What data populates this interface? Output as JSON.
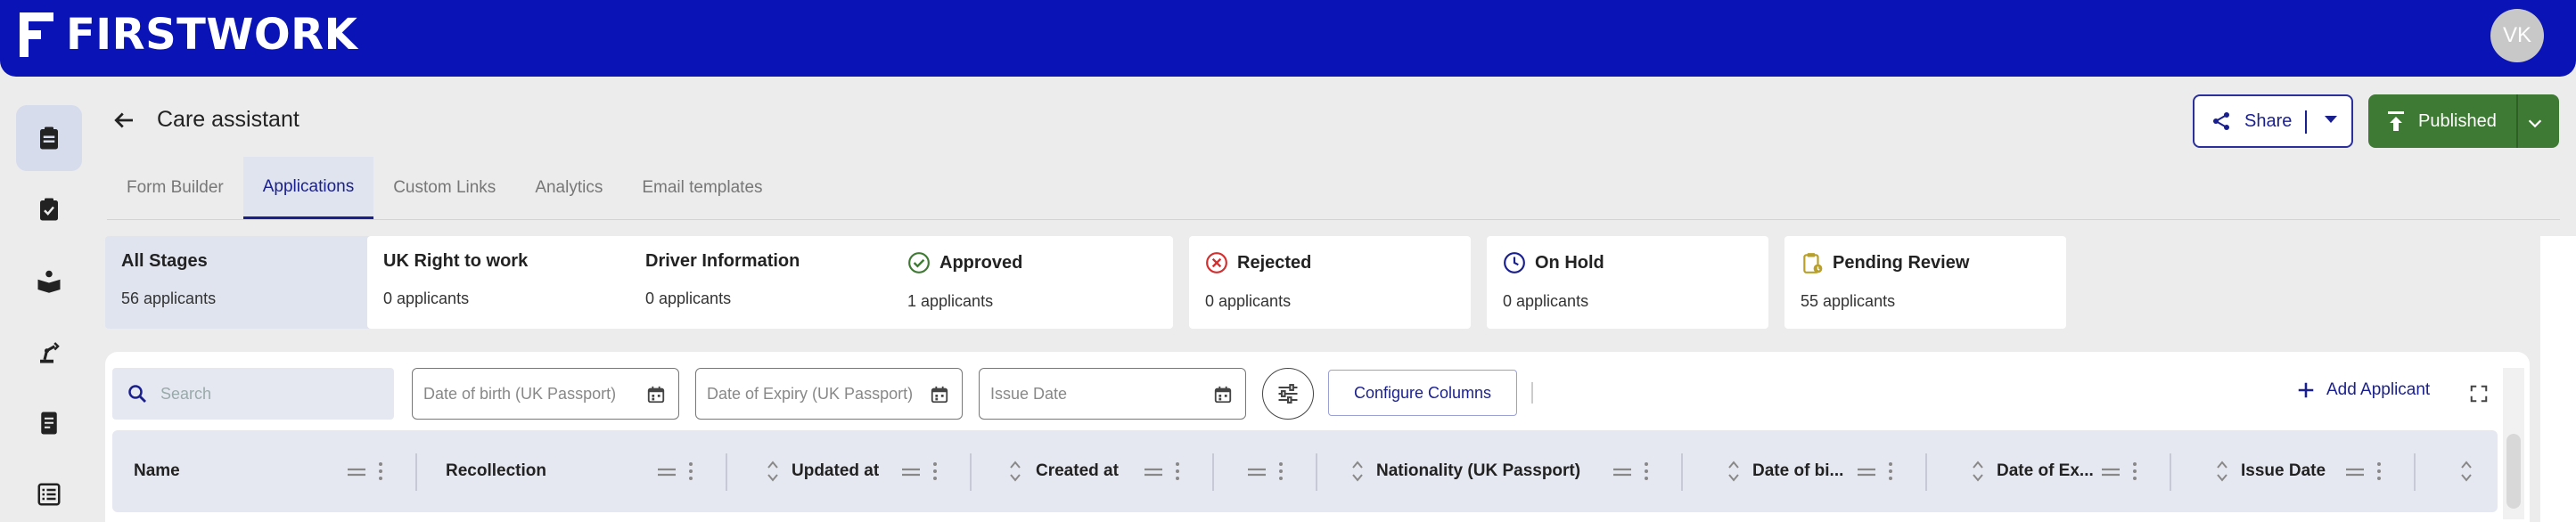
{
  "brand": {
    "name": "FIRSTWORK"
  },
  "user": {
    "initials": "VK"
  },
  "page": {
    "title": "Care assistant"
  },
  "actions": {
    "share_label": "Share",
    "publish_label": "Published"
  },
  "tabs": [
    {
      "label": "Form Builder"
    },
    {
      "label": "Applications"
    },
    {
      "label": "Custom Links"
    },
    {
      "label": "Analytics"
    },
    {
      "label": "Email templates"
    }
  ],
  "stages": [
    {
      "title": "All Stages",
      "count": "56 applicants"
    },
    {
      "title": "UK Right to work",
      "count": "0 applicants"
    },
    {
      "title": "Driver Information",
      "count": "0 applicants"
    },
    {
      "title": "Approved",
      "count": "1 applicants"
    },
    {
      "title": "Rejected",
      "count": "0 applicants"
    },
    {
      "title": "On Hold",
      "count": "0 applicants"
    },
    {
      "title": "Pending Review",
      "count": "55 applicants"
    }
  ],
  "toolbar": {
    "search_placeholder": "Search",
    "date_fields": [
      "Date of birth (UK Passport)",
      "Date of Expiry (UK Passport)",
      "Issue Date"
    ],
    "configure_columns": "Configure Columns",
    "add_applicant": "Add Applicant"
  },
  "table": {
    "columns": [
      "Name",
      "Recollection",
      "Updated at",
      "Created at",
      "",
      "Nationality (UK Passport)",
      "Date of bi...",
      "Date of Ex...",
      "Issue Date"
    ]
  },
  "colors": {
    "brand_blue": "#0a13b6",
    "accent_navy": "#1a1f8e",
    "publish_green": "#3f7a35",
    "approved_green": "#3f7a35",
    "rejected_red": "#d32f2f",
    "hold_blue": "#1a1f8e",
    "pending_olive": "#b8a02a"
  }
}
